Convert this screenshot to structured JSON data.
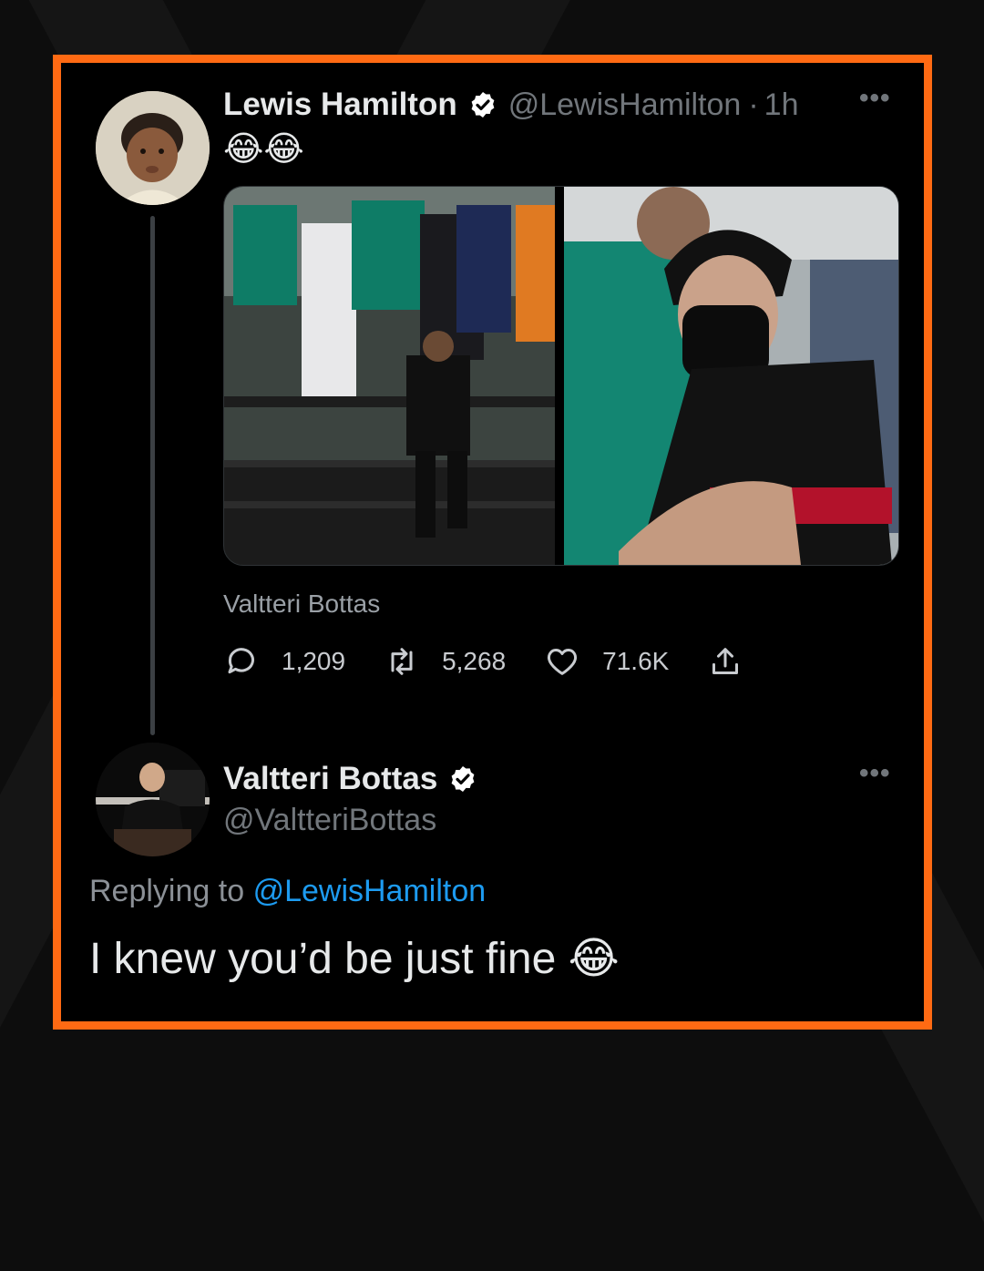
{
  "original_tweet": {
    "author_name": "Lewis Hamilton",
    "author_handle": "@LewisHamilton",
    "timestamp": "1h",
    "separator": "·",
    "text": "😂😂",
    "media_caption": "Valtteri Bottas",
    "actions": {
      "replies": "1,209",
      "retweets": "5,268",
      "likes": "71.6K"
    },
    "more_icon": "more-options-icon"
  },
  "reply_tweet": {
    "author_name": "Valtteri Bottas",
    "author_handle": "@ValtteriBottas",
    "replying_prefix": "Replying to",
    "replying_handle": "@LewisHamilton",
    "text": "I knew you’d be just fine 😂",
    "more_icon": "more-options-icon"
  },
  "colors": {
    "frame_border": "#ff6a13",
    "link": "#1d9bf0",
    "verified_badge": "#ffffff"
  }
}
